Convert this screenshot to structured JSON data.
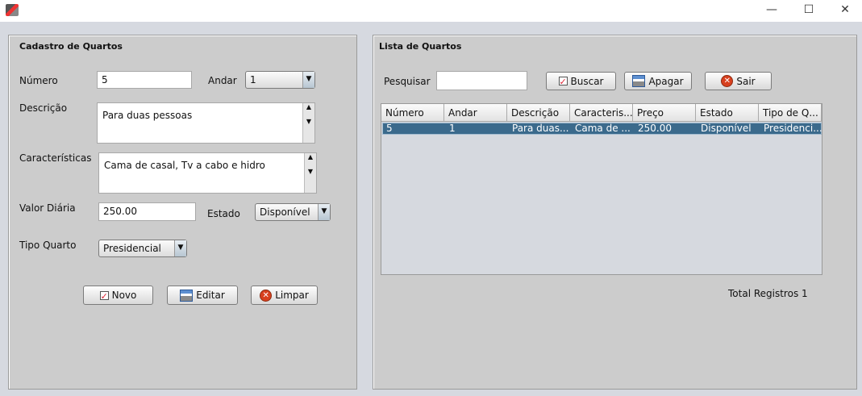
{
  "window": {
    "minimize": "—",
    "maximize": "☐",
    "close": "✕"
  },
  "form": {
    "title": "Cadastro de Quartos",
    "numero_label": "Número",
    "numero_value": "5",
    "andar_label": "Andar",
    "andar_value": "1",
    "descricao_label": "Descrição",
    "descricao_value": "Para duas pessoas",
    "caracteristicas_label": "Características",
    "caracteristicas_value": "Cama de casal, Tv a cabo e hidro",
    "valor_label": "Valor Diária",
    "valor_value": "250.00",
    "estado_label": "Estado",
    "estado_value": "Disponível",
    "tipo_label": "Tipo Quarto",
    "tipo_value": "Presidencial",
    "novo": "Novo",
    "editar": "Editar",
    "limpar": "Limpar"
  },
  "list": {
    "title": "Lista de Quartos",
    "pesquisar_label": "Pesquisar",
    "pesquisar_value": "",
    "buscar": "Buscar",
    "apagar": "Apagar",
    "sair": "Sair",
    "columns": [
      "Número",
      "Andar",
      "Descrição",
      "Caracteris...",
      "Preço",
      "Estado",
      "Tipo de Q..."
    ],
    "rows": [
      [
        "5",
        "1",
        "Para duas...",
        "Cama de ...",
        "250.00",
        "Disponível",
        "Presidenci..."
      ]
    ],
    "total": "Total Registros 1"
  }
}
